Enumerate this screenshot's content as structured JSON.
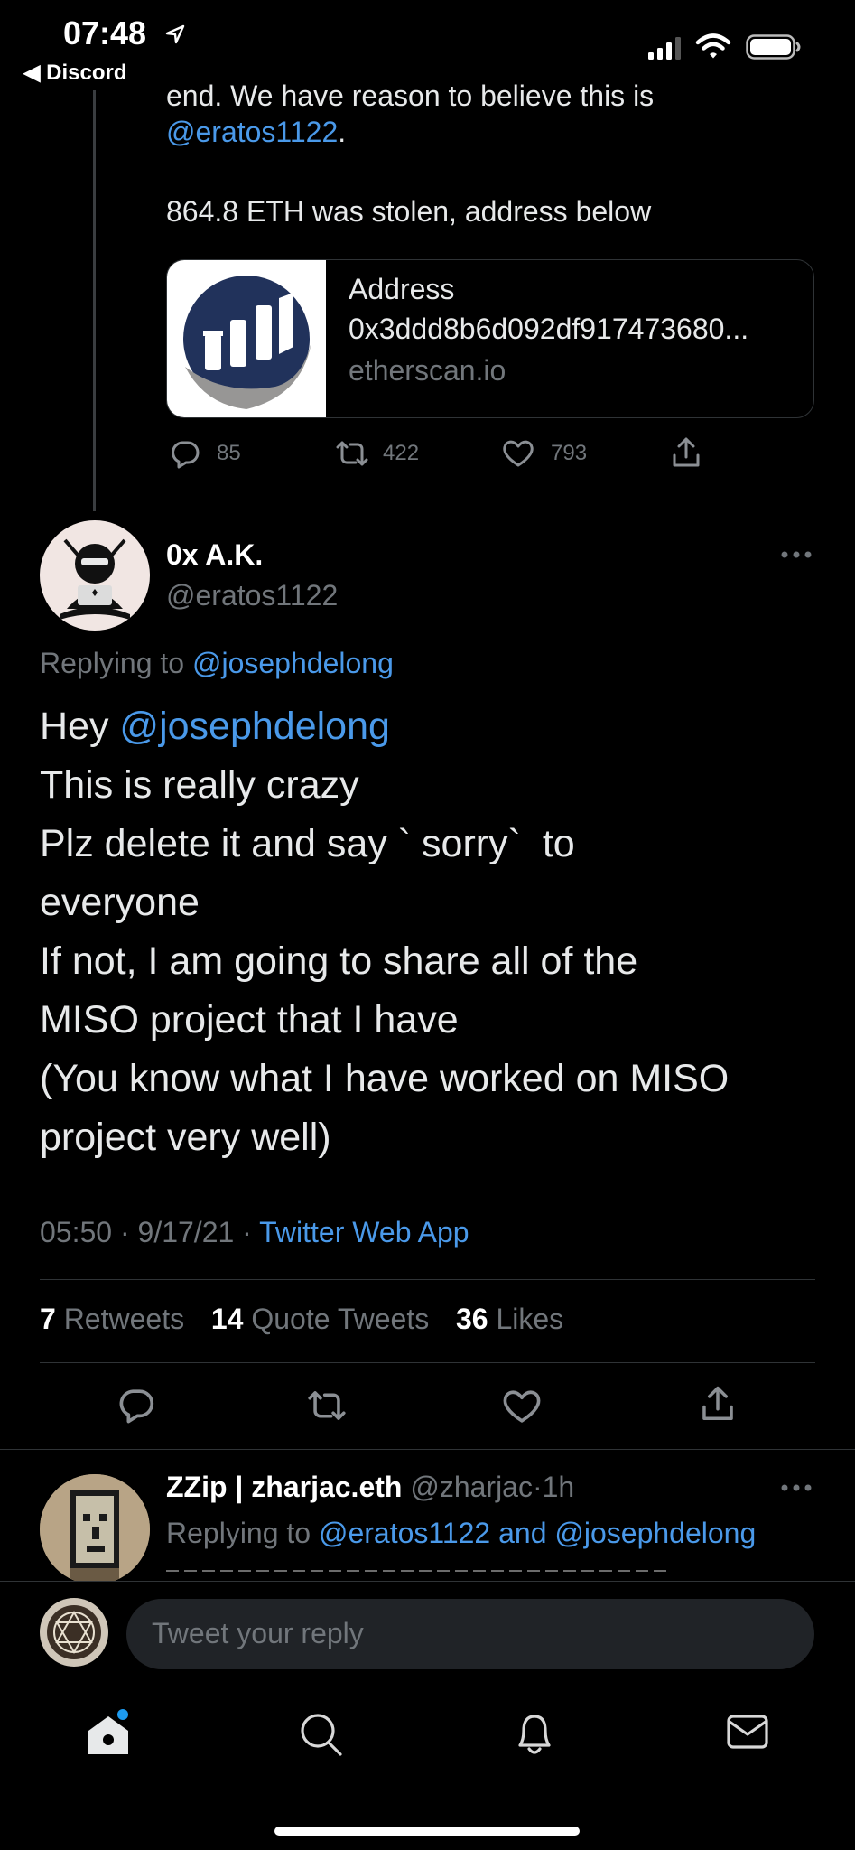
{
  "status_bar": {
    "time": "07:48",
    "back_label": "◀ Discord"
  },
  "quoted": {
    "text_line1": "end. We have reason to believe this is",
    "mention": "@eratos1122",
    "period": ".",
    "text_line3": "864.8 ETH was stolen, address below",
    "link_card": {
      "title": "Address",
      "subtitle": "0x3ddd8b6d092df917473680...",
      "domain": "etherscan.io"
    },
    "actions": {
      "replies": "85",
      "retweets": "422",
      "likes": "793"
    }
  },
  "tweet": {
    "display_name": "0x A.K.",
    "handle": "@eratos1122",
    "replying_prefix": "Replying to",
    "replying_to": "@josephdelong",
    "body": {
      "greeting": "Hey",
      "mention": "@josephdelong",
      "lines": [
        "This is really crazy",
        "Plz delete it and say ` sorry`  to",
        "everyone",
        "If not, I am going to share all of the",
        "MISO project that I have",
        "(You know what I have worked on MISO",
        "project very well)"
      ]
    },
    "time": "05:50",
    "date": "9/17/21",
    "source": "Twitter Web App",
    "stats": {
      "retweets_count": "7",
      "retweets_label": "Retweets",
      "quotes_count": "14",
      "quotes_label": "Quote Tweets",
      "likes_count": "36",
      "likes_label": "Likes"
    }
  },
  "reply_preview": {
    "display_name": "ZZip | zharjac.eth",
    "handle": "@zharjac",
    "time": "1h",
    "replying_prefix": "Replying to",
    "replying_to": "@eratos1122 and @josephdelong"
  },
  "composer": {
    "placeholder": "Tweet your reply"
  },
  "colors": {
    "accent": "#4a99e9",
    "background": "#000000",
    "text": "#e7e9ea",
    "muted": "#71767b"
  }
}
